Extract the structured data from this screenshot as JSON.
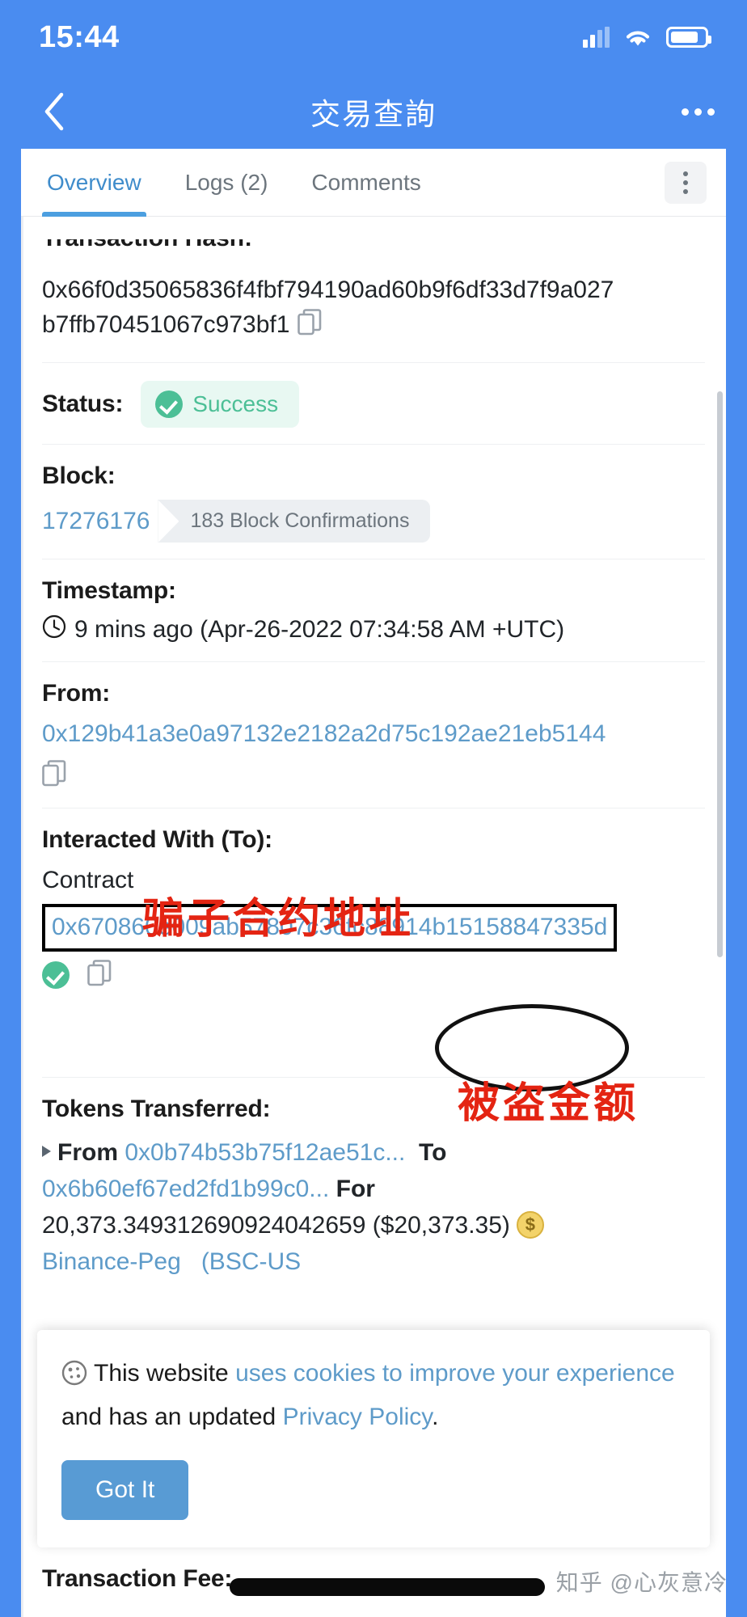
{
  "statusbar": {
    "time": "15:44",
    "signal_icon": "signal-bars-icon",
    "wifi_icon": "wifi-icon",
    "battery_icon": "battery-icon"
  },
  "navbar": {
    "back_icon": "chevron-left-icon",
    "title": "交易查詢",
    "more_icon": "more-horizontal-icon"
  },
  "tabs": [
    {
      "label": "Overview",
      "active": true
    },
    {
      "label": "Logs (2)",
      "active": false
    },
    {
      "label": "Comments",
      "active": false
    }
  ],
  "tab_menu_icon": "kebab-menu-icon",
  "fields": {
    "transaction_hash": {
      "label": "Transaction Hash:",
      "value_line1": "0x66f0d35065836f4fbf794190ad60b9f6df33d7f9a027",
      "value_line2": "b7ffb70451067c973bf1",
      "copy_icon": "copy-icon"
    },
    "status": {
      "label": "Status:",
      "badge": "Success",
      "badge_icon": "check-circle-icon",
      "badge_bg": "#e8f8f2",
      "badge_color": "#4cbf96"
    },
    "block": {
      "label": "Block:",
      "number": "17276176",
      "confirmations": "183 Block Confirmations"
    },
    "timestamp": {
      "label": "Timestamp:",
      "clock_icon": "clock-icon",
      "value": "9 mins ago (Apr-26-2022 07:34:58 AM +UTC)"
    },
    "from": {
      "label": "From:",
      "address": "0x129b41a3e0a97132e2182a2d75c192ae21eb5144",
      "copy_icon": "copy-icon"
    },
    "interacted_with": {
      "label": "Interacted With (To):",
      "sub_label": "Contract",
      "address": "0x670860e009ab57807c36fc88914b15158847335d",
      "verified_icon": "check-circle-icon",
      "copy_icon": "copy-icon"
    },
    "tokens_transferred": {
      "label": "Tokens Transferred:",
      "caret_icon": "caret-right-icon",
      "from_word": "From",
      "from_address": "0x0b74b53b75f12ae51c...",
      "to_word": "To",
      "to_address": "0x6b60ef67ed2fd1b99c0...",
      "for_word": "For",
      "amount": "20,373.349312690924042659",
      "amount_usd": "($20,373.35)",
      "coin_icon": "token-coin-icon",
      "token_name": "Binance-Peg",
      "token_symbol": "(BSC-US"
    },
    "transaction_fee": {
      "label": "Transaction Fee:"
    }
  },
  "annotations": {
    "contract_note": "骗子合约地址",
    "amount_note": "被盗金额",
    "note_color": "#e42412"
  },
  "cookie_banner": {
    "cookie_icon": "cookie-icon",
    "text_1": "This website ",
    "link_1": "uses cookies to improve your experience",
    "text_2": " and has an updated ",
    "link_2": "Privacy Policy",
    "text_3": ".",
    "button": "Got It"
  },
  "watermark": "知乎 @心灰意冷"
}
